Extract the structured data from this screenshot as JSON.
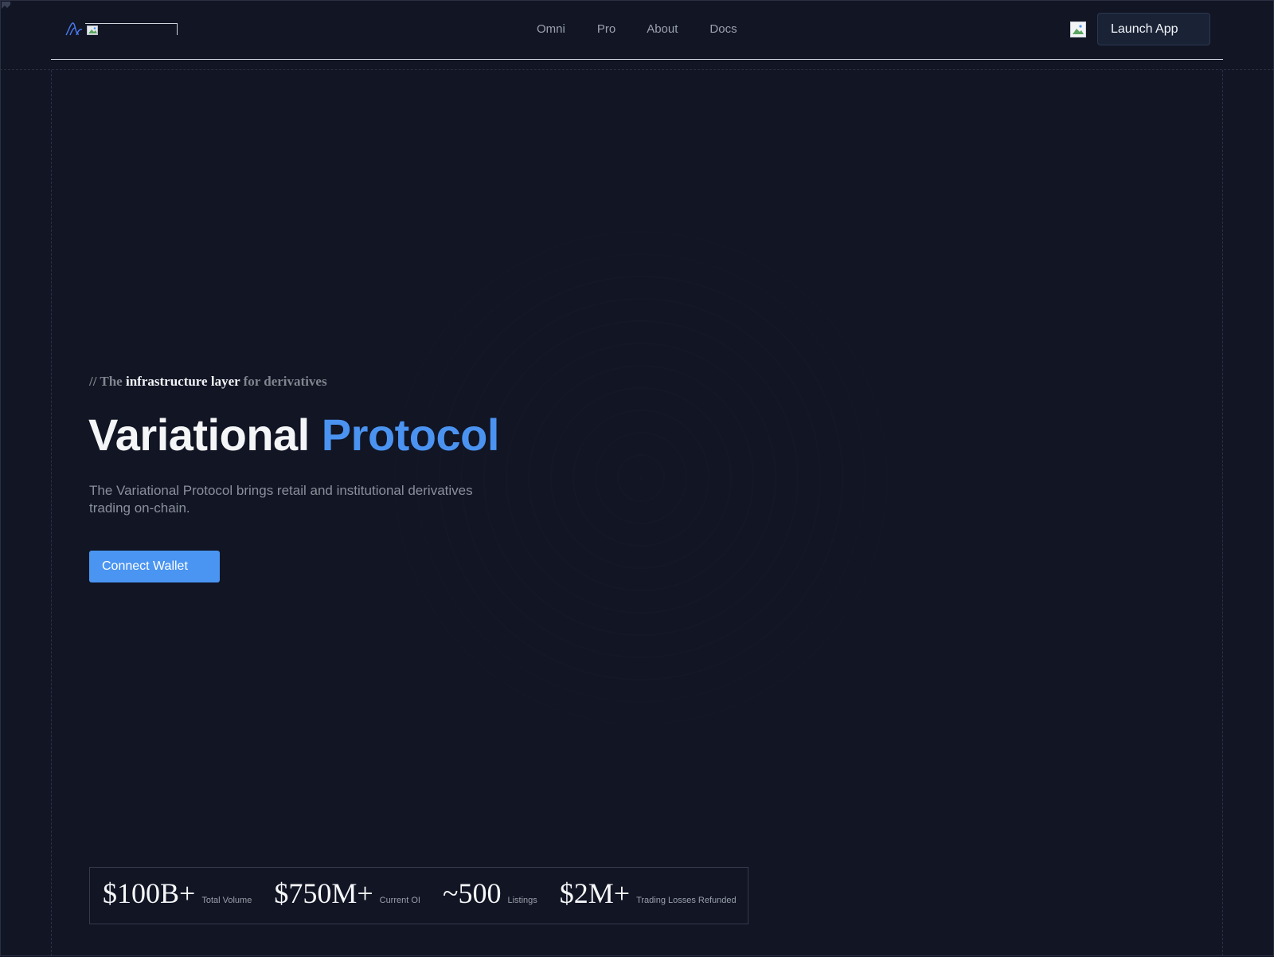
{
  "header": {
    "nav": [
      "Omni",
      "Pro",
      "About",
      "Docs"
    ],
    "launch_label": "Launch App",
    "logo_icon": "variational-logo-icon",
    "theme_icon": "broken-image-icon"
  },
  "hero": {
    "eyebrow_prefix": "// The ",
    "eyebrow_strong": "infrastructure layer",
    "eyebrow_suffix": " for derivatives",
    "title_main": "Variational ",
    "title_accent": "Protocol",
    "subtitle": "The Variational Protocol brings retail and institutional derivatives trading on-chain.",
    "cta_label": "Connect Wallet"
  },
  "stats": [
    {
      "value": "$100B+",
      "label": "Total Volume"
    },
    {
      "value": "$750M+",
      "label": "Current OI"
    },
    {
      "value": "~500",
      "label": "Listings"
    },
    {
      "value": "$2M+",
      "label": "Trading Losses Refunded"
    }
  ],
  "colors": {
    "background": "#111524",
    "accent": "#4b93f1",
    "button": "#4a95f2",
    "launch_button": "#1a2336"
  }
}
